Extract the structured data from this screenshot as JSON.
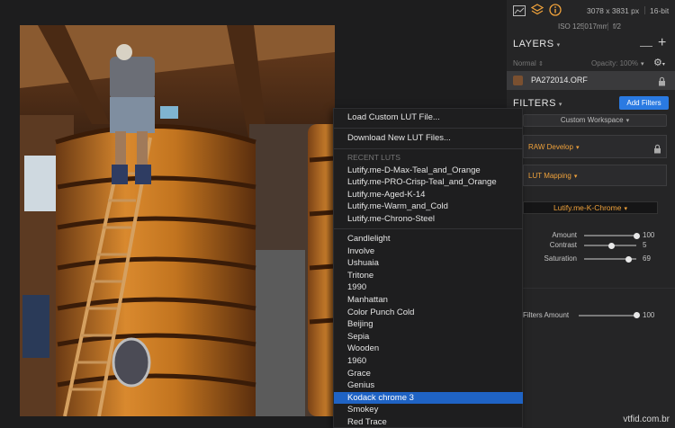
{
  "photo": {
    "description_icon": "photo-canvas"
  },
  "header": {
    "dimensions": "3078 x 3831 px",
    "bit_depth": "16-bit",
    "iso": "ISO 1250",
    "focal_length": "17mm",
    "aperture": "f/2"
  },
  "layers": {
    "title": "LAYERS",
    "blend_mode": "Normal",
    "opacity_label": "Opacity: 100%",
    "layer_name": "PA272014.ORF"
  },
  "filters": {
    "title": "FILTERS",
    "add_button": "Add Filters",
    "workspace": "Custom Workspace",
    "raw_develop": "RAW Develop",
    "lut_mapping": "LUT Mapping",
    "lut_selected": "Lutify.me-K-Chrome",
    "sliders": [
      {
        "label": "Amount",
        "value": "100",
        "level": 1.0
      },
      {
        "label": "Contrast",
        "value": "5",
        "level": 0.52
      },
      {
        "label": "Saturation",
        "value": "69",
        "level": 0.85
      }
    ],
    "filters_amount_label": "Filters Amount",
    "filters_amount_value": "100",
    "filters_amount_level": 1.0
  },
  "menu": {
    "load_custom": "Load Custom LUT File...",
    "download_new": "Download New LUT Files...",
    "recent_header": "RECENT LUTS",
    "recent": [
      "Lutify.me-D-Max-Teal_and_Orange",
      "Lutify.me-PRO-Crisp-Teal_and_Orange",
      "Lutify.me-Aged-K-14",
      "Lutify.me-Warm_and_Cold",
      "Lutify.me-Chrono-Steel"
    ],
    "luts": [
      "Candlelight",
      "Involve",
      "Ushuaia",
      "Tritone",
      "1990",
      "Manhattan",
      "Color Punch Cold",
      "Beijing",
      "Sepia",
      "Wooden",
      "1960",
      "Grace",
      "Genius",
      "Kodack chrome  3",
      "Smokey",
      "Red Trace"
    ],
    "selected_index": 13
  },
  "watermark": "vtfid.com.br",
  "colors": {
    "accent_orange": "#f0a23b",
    "selection_blue": "#1f63c4",
    "add_button_blue": "#2a7ae2"
  }
}
